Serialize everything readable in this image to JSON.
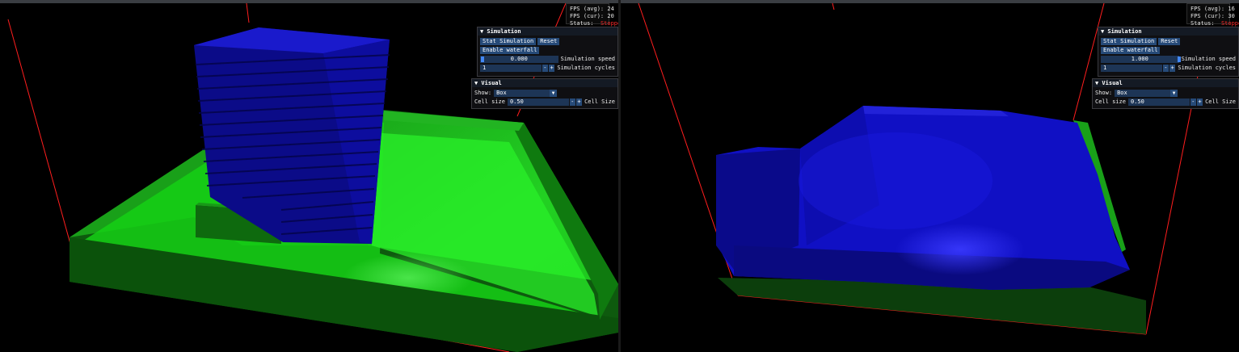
{
  "left": {
    "stats": {
      "fps_avg_label": "FPS (avg):",
      "fps_avg": "24",
      "fps_cur_label": "FPS (cur):",
      "fps_cur": "20",
      "status_label": "Status:",
      "status": "Stopped"
    },
    "simulation": {
      "header": "▼ Simulation",
      "start_button": "Stat Simulation",
      "reset_button": "Reset",
      "waterfall_button": "Enable waterfall",
      "speed_value": "0.000",
      "speed_label": "Simulation speed",
      "speed_level": 0.0,
      "cycles_value": "1",
      "cycles_label": "Simulation cycles",
      "minus": "-",
      "plus": "+"
    },
    "visual": {
      "header": "▼ Visual",
      "show_label": "Show:",
      "show_value": "Box",
      "cell_size_label_left": "Cell size",
      "cell_size_value": "0.50",
      "cell_size_label_right": "Cell Size",
      "minus": "-",
      "plus": "+"
    }
  },
  "right": {
    "stats": {
      "fps_avg_label": "FPS (avg):",
      "fps_avg": "16",
      "fps_cur_label": "FPS (cur):",
      "fps_cur": "30",
      "status_label": "Status:",
      "status": "Stopped"
    },
    "simulation": {
      "header": "▼ Simulation",
      "start_button": "Stat Simulation",
      "reset_button": "Reset",
      "waterfall_button": "Enable waterfall",
      "speed_value": "1.000",
      "speed_label": "Simulation speed",
      "speed_level": 1.0,
      "cycles_value": "1",
      "cycles_label": "Simulation cycles",
      "minus": "-",
      "plus": "+"
    },
    "visual": {
      "header": "▼ Visual",
      "show_label": "Show:",
      "show_value": "Box",
      "cell_size_label_left": "Cell size",
      "cell_size_value": "0.50",
      "cell_size_label_right": "Cell Size",
      "minus": "-",
      "plus": "+"
    }
  },
  "colors": {
    "water": "#1414d8",
    "terrain": "#14c814",
    "bounds": "#ff1e1e",
    "status_stopped": "#ff2a2a"
  }
}
